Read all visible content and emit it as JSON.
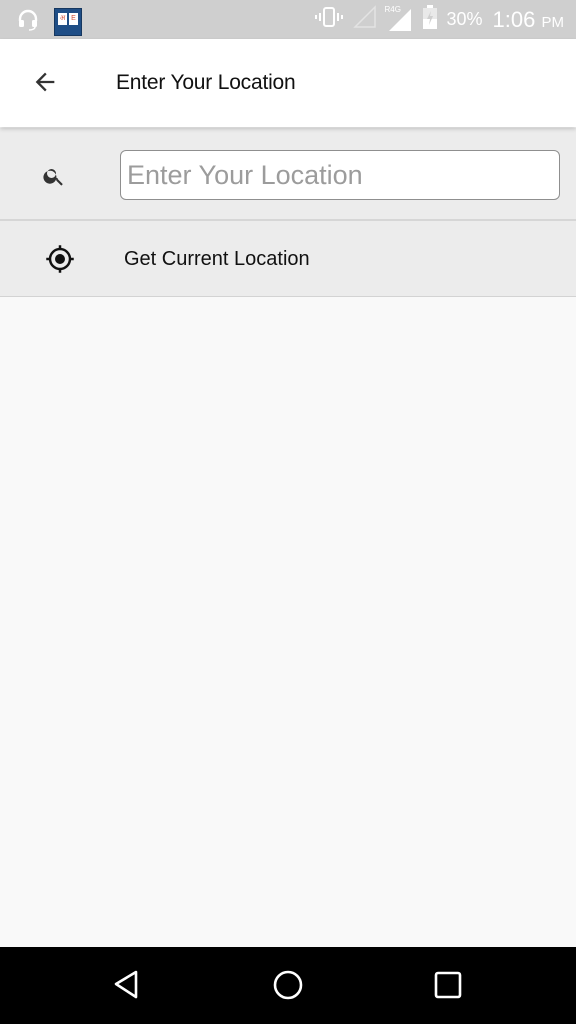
{
  "status_bar": {
    "battery_percent": "30%",
    "time": "1:06",
    "ampm": "PM",
    "network_label": "R4G",
    "icons": [
      "headset-icon",
      "app-notification-icon",
      "vibrate-icon",
      "signal-empty-icon",
      "signal-r4g-icon",
      "battery-charging-icon"
    ]
  },
  "toolbar": {
    "back_icon": "arrow-left-icon",
    "title": "Enter Your Location"
  },
  "search": {
    "icon": "search-icon",
    "placeholder": "Enter Your Location",
    "value": ""
  },
  "current_location": {
    "icon": "gps-fixed-icon",
    "label": "Get Current Location"
  },
  "nav_bar": {
    "buttons": [
      "back",
      "home",
      "recents"
    ]
  }
}
